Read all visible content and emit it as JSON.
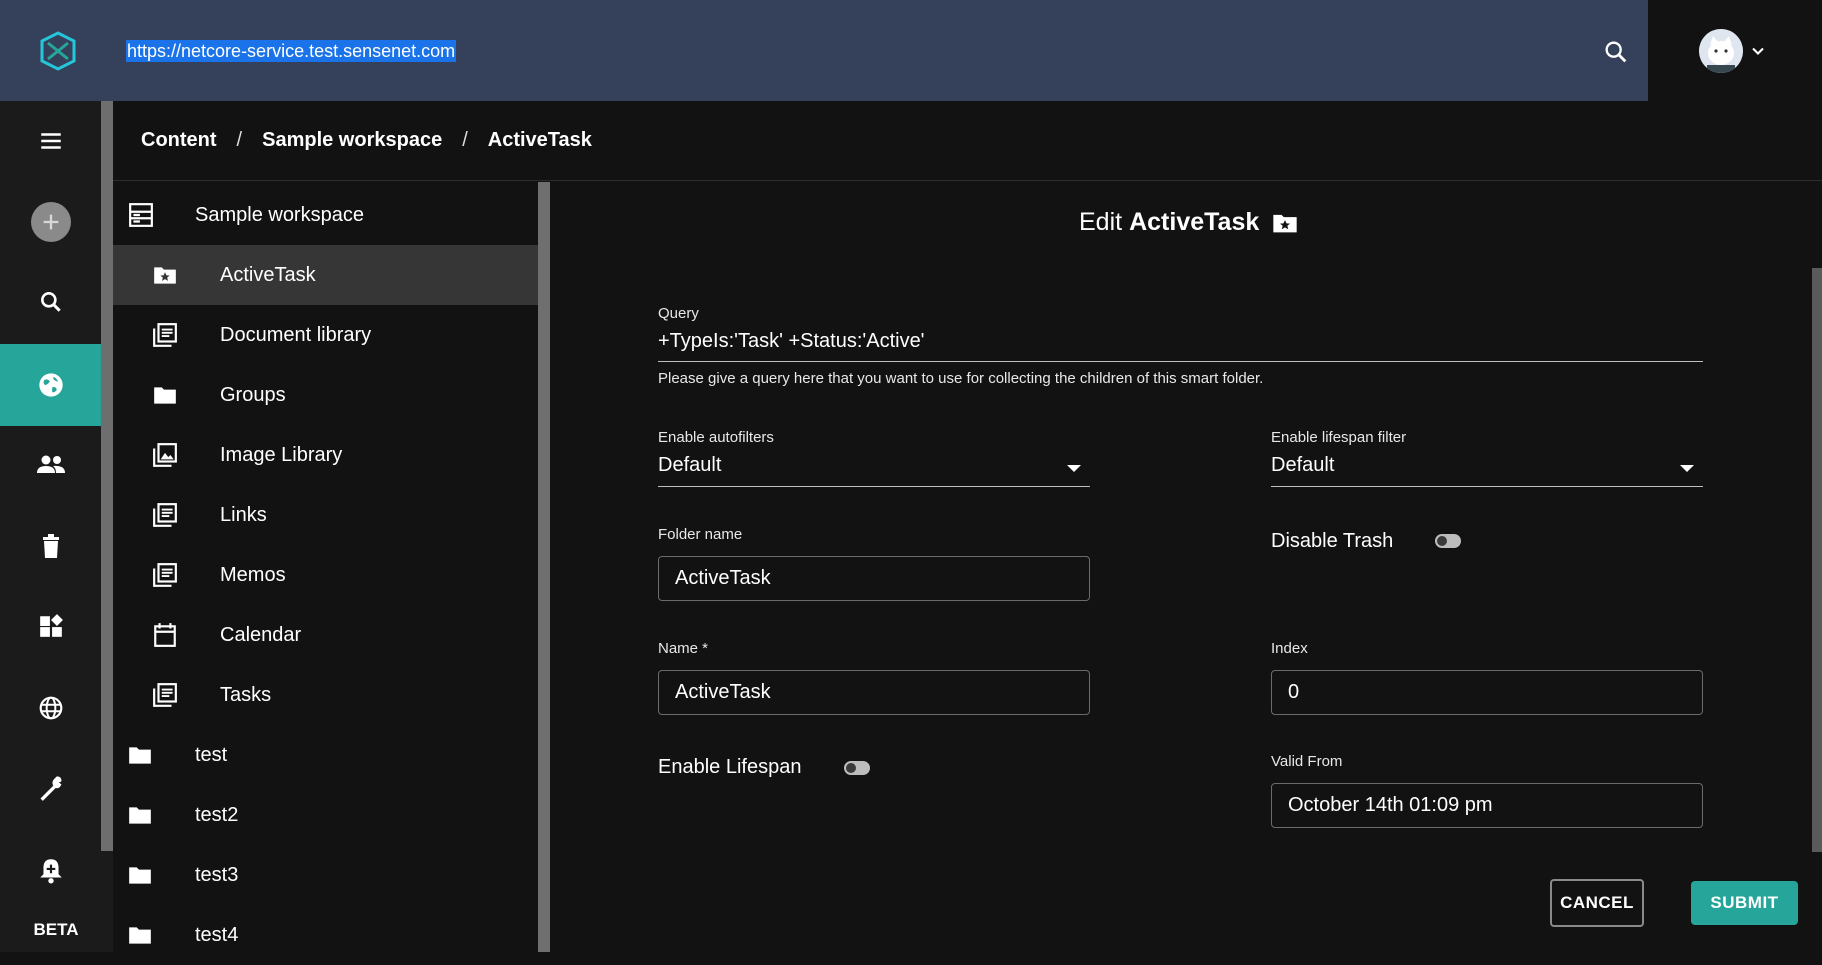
{
  "header": {
    "url": "https://netcore-service.test.sensenet.com",
    "search_icon": "search-icon",
    "avatar_icon": "avatar",
    "chevron_icon": "chevron-down-icon"
  },
  "rail": {
    "items": [
      {
        "icon": "menu-icon"
      },
      {
        "icon": "add-icon"
      },
      {
        "icon": "search-icon"
      },
      {
        "icon": "globe-icon",
        "active": true
      },
      {
        "icon": "users-icon"
      },
      {
        "icon": "trash-icon"
      },
      {
        "icon": "widgets-icon"
      },
      {
        "icon": "language-icon"
      },
      {
        "icon": "wrench-icon"
      },
      {
        "icon": "notification-icon"
      }
    ],
    "beta_label": "BETA",
    "active_color": "#26a69a"
  },
  "breadcrumb": {
    "items": [
      "Content",
      "Sample workspace",
      "ActiveTask"
    ],
    "separator": "/"
  },
  "tree": {
    "items": [
      {
        "label": "Sample workspace",
        "icon": "workspace-icon",
        "level": 0
      },
      {
        "label": "ActiveTask",
        "icon": "smart-folder-icon",
        "level": 1,
        "selected": true
      },
      {
        "label": "Document library",
        "icon": "library-icon",
        "level": 1
      },
      {
        "label": "Groups",
        "icon": "folder-icon",
        "level": 1
      },
      {
        "label": "Image Library",
        "icon": "image-library-icon",
        "level": 1
      },
      {
        "label": "Links",
        "icon": "library-icon",
        "level": 1
      },
      {
        "label": "Memos",
        "icon": "library-icon",
        "level": 1
      },
      {
        "label": "Calendar",
        "icon": "calendar-icon",
        "level": 1
      },
      {
        "label": "Tasks",
        "icon": "library-icon",
        "level": 1
      },
      {
        "label": "test",
        "icon": "folder-icon",
        "level": 0
      },
      {
        "label": "test2",
        "icon": "folder-icon",
        "level": 0
      },
      {
        "label": "test3",
        "icon": "folder-icon",
        "level": 0
      },
      {
        "label": "test4",
        "icon": "folder-icon",
        "level": 0
      }
    ]
  },
  "form": {
    "title_prefix": "Edit",
    "title_name": "ActiveTask",
    "title_icon": "smart-folder-icon",
    "query": {
      "label": "Query",
      "value": "+TypeIs:'Task' +Status:'Active'",
      "helper": "Please give a query here that you want to use for collecting the children of this smart folder."
    },
    "enable_autofilters": {
      "label": "Enable autofilters",
      "value": "Default"
    },
    "enable_lifespan_filter": {
      "label": "Enable lifespan filter",
      "value": "Default"
    },
    "folder_name": {
      "label": "Folder name",
      "value": "ActiveTask"
    },
    "disable_trash": {
      "label": "Disable Trash",
      "checked": false
    },
    "name": {
      "label": "Name *",
      "value": "ActiveTask"
    },
    "index": {
      "label": "Index",
      "value": "0"
    },
    "enable_lifespan": {
      "label": "Enable Lifespan",
      "checked": false
    },
    "valid_from": {
      "label": "Valid From",
      "value": "October 14th 01:09 pm"
    },
    "cancel_label": "CANCEL",
    "submit_label": "SUBMIT"
  }
}
